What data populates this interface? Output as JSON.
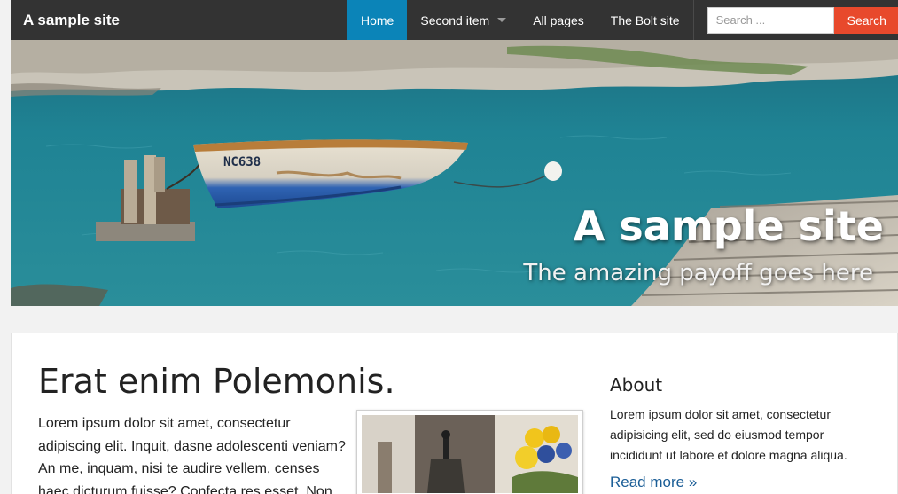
{
  "header": {
    "site_title": "A sample site",
    "nav": [
      {
        "label": "Home",
        "active": true
      },
      {
        "label": "Second item",
        "has_dropdown": true
      },
      {
        "label": "All pages"
      },
      {
        "label": "The Bolt site"
      }
    ],
    "search": {
      "placeholder": "Search ...",
      "button_label": "Search"
    }
  },
  "hero": {
    "title": "A sample site",
    "subtitle": "The amazing payoff goes here",
    "boat_label": "NC638"
  },
  "main": {
    "post_title": "Erat enim Polemonis.",
    "post_text": "Lorem ipsum dolor sit amet, consectetur adipiscing elit. Inquit, dasne adolescenti veniam? An me, inquam, nisi te audire vellem, censes haec dicturum fuisse? Confecta res esset. Non"
  },
  "sidebar": {
    "title": "About",
    "text": "Lorem ipsum dolor sit amet, consectetur adipisicing elit, sed do eiusmod tempor incididunt ut labore et dolore magna aliqua.",
    "link_label": "Read more »"
  },
  "colors": {
    "topbar": "#333333",
    "nav_active": "#0b84b8",
    "search_button": "#e8492c",
    "link": "#1a5d96"
  }
}
